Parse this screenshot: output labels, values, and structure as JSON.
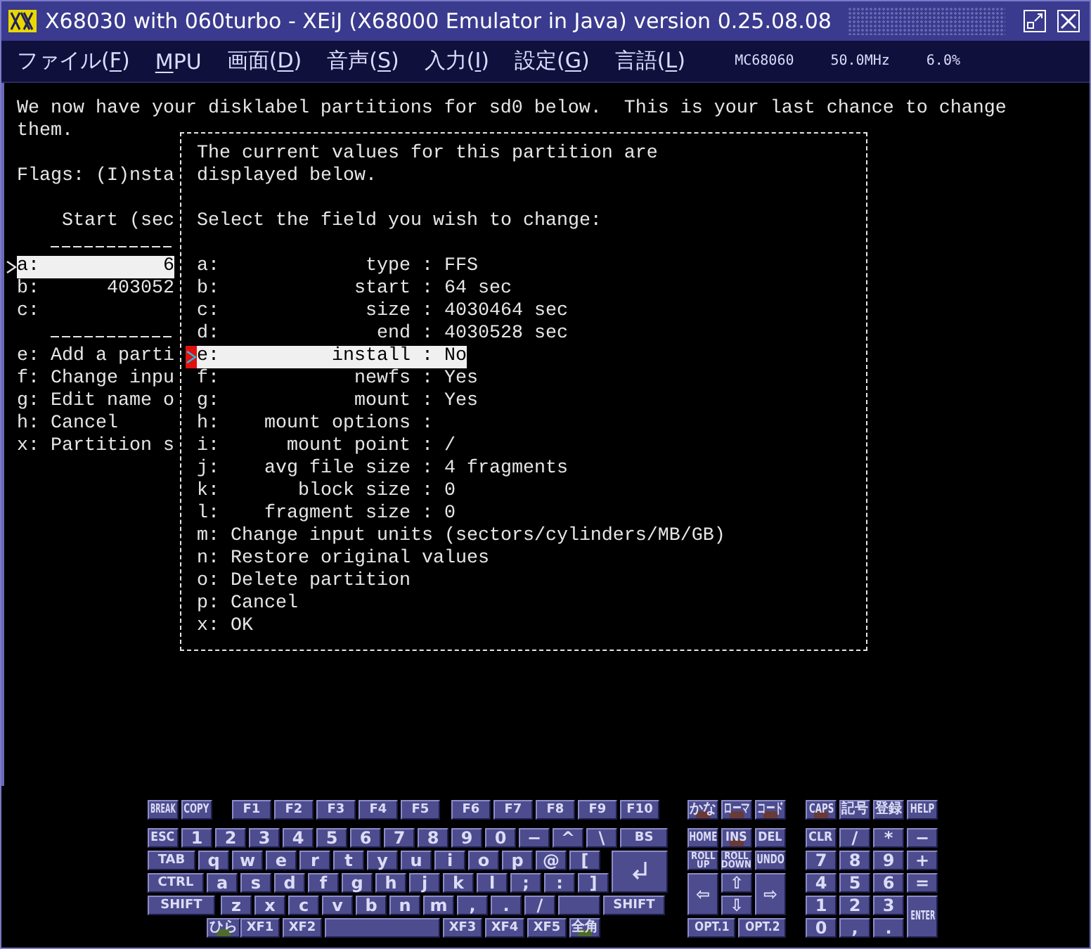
{
  "window": {
    "title": "X68030 with 060turbo - XEiJ (X68000 Emulator in Java) version 0.25.08.08"
  },
  "menu": [
    {
      "before": "ファイル(",
      "key": "F",
      "after": ")"
    },
    {
      "key": "M",
      "after": "PU"
    },
    {
      "before": "画面(",
      "key": "D",
      "after": ")"
    },
    {
      "before": "音声(",
      "key": "S",
      "after": ")"
    },
    {
      "before": "入力(",
      "key": "I",
      "after": ")"
    },
    {
      "before": "設定(",
      "key": "G",
      "after": ")"
    },
    {
      "before": "言語(",
      "key": "L",
      "after": ")"
    }
  ],
  "status": [
    "MC68060",
    "50.0MHz",
    "6.0%"
  ],
  "terminal": {
    "intro": "We now have your disklabel partitions for sd0 below.  This is your last chance to change them.",
    "flags": "Flags: (I)nsta",
    "table_header": "Start (sec",
    "partitions": [
      {
        "text": "a:           6",
        "selected": true
      },
      {
        "text": "b:      403052",
        "selected": false
      },
      {
        "text": "c:",
        "selected": false
      }
    ],
    "actions": [
      "e: Add a parti",
      "f: Change inpu",
      "g: Edit name o",
      "h: Cancel",
      "x: Partition s"
    ]
  },
  "dialog": {
    "intro": "The current values for this partition are displayed below.",
    "prompt": "Select the field you wish to change:",
    "fields": [
      {
        "text": "a:             type : FFS",
        "selected": false
      },
      {
        "text": "b:            start : 64 sec",
        "selected": false
      },
      {
        "text": "c:             size : 4030464 sec",
        "selected": false
      },
      {
        "text": "d:              end : 4030528 sec",
        "selected": false
      },
      {
        "text": "e:          install : No",
        "selected": true
      },
      {
        "text": "f:            newfs : Yes",
        "selected": false
      },
      {
        "text": "g:            mount : Yes",
        "selected": false
      },
      {
        "text": "h:    mount options :",
        "selected": false
      },
      {
        "text": "i:      mount point : /",
        "selected": false
      },
      {
        "text": "j:    avg file size : 4 fragments",
        "selected": false
      },
      {
        "text": "k:       block size : 0",
        "selected": false
      },
      {
        "text": "l:    fragment size : 0",
        "selected": false
      }
    ],
    "options": [
      "m: Change input units (sectors/cylinders/MB/GB)",
      "n: Restore original values",
      "o: Delete partition",
      "p: Cancel",
      "x: OK"
    ]
  },
  "keyboard": {
    "main": [
      [
        {
          "label": "BREAK",
          "kind": "key"
        },
        {
          "label": "COPY",
          "kind": "copy"
        },
        {
          "label": "F1",
          "kind": "fn"
        },
        {
          "label": "F2",
          "kind": "fn"
        },
        {
          "label": "F3",
          "kind": "fn"
        },
        {
          "label": "F4",
          "kind": "fn"
        },
        {
          "label": "F5",
          "kind": "fngap"
        },
        {
          "label": "F6",
          "kind": "fn"
        },
        {
          "label": "F7",
          "kind": "fn"
        },
        {
          "label": "F8",
          "kind": "fn"
        },
        {
          "label": "F9",
          "kind": "fn"
        },
        {
          "label": "F10",
          "kind": "fn"
        }
      ],
      [
        {
          "label": "ESC",
          "kind": "key"
        },
        {
          "label": "1",
          "kind": "key"
        },
        {
          "label": "2",
          "kind": "key"
        },
        {
          "label": "3",
          "kind": "key"
        },
        {
          "label": "4",
          "kind": "key"
        },
        {
          "label": "5",
          "kind": "key"
        },
        {
          "label": "6",
          "kind": "key"
        },
        {
          "label": "7",
          "kind": "key"
        },
        {
          "label": "8",
          "kind": "key"
        },
        {
          "label": "9",
          "kind": "key"
        },
        {
          "label": "0",
          "kind": "key"
        },
        {
          "label": "−",
          "kind": "key"
        },
        {
          "label": "^",
          "kind": "key"
        },
        {
          "label": "\\",
          "kind": "key"
        },
        {
          "label": "BS",
          "kind": "bs"
        }
      ],
      [
        {
          "label": "TAB",
          "kind": "tab"
        },
        {
          "label": "q",
          "kind": "key"
        },
        {
          "label": "w",
          "kind": "key"
        },
        {
          "label": "e",
          "kind": "key"
        },
        {
          "label": "r",
          "kind": "key"
        },
        {
          "label": "t",
          "kind": "key"
        },
        {
          "label": "y",
          "kind": "key"
        },
        {
          "label": "u",
          "kind": "key"
        },
        {
          "label": "i",
          "kind": "key"
        },
        {
          "label": "o",
          "kind": "key"
        },
        {
          "label": "p",
          "kind": "key"
        },
        {
          "label": "@",
          "kind": "key"
        },
        {
          "label": "[",
          "kind": "key"
        },
        {
          "kind": "return"
        }
      ],
      [
        {
          "label": "CTRL",
          "kind": "ctrl"
        },
        {
          "label": "a",
          "kind": "key"
        },
        {
          "label": "s",
          "kind": "key"
        },
        {
          "label": "d",
          "kind": "key"
        },
        {
          "label": "f",
          "kind": "key"
        },
        {
          "label": "g",
          "kind": "key"
        },
        {
          "label": "h",
          "kind": "key"
        },
        {
          "label": "j",
          "kind": "key"
        },
        {
          "label": "k",
          "kind": "key"
        },
        {
          "label": "l",
          "kind": "key"
        },
        {
          "label": ";",
          "kind": "key"
        },
        {
          "label": ":",
          "kind": "key"
        },
        {
          "label": "]",
          "kind": "key"
        }
      ],
      [
        {
          "label": "SHIFT",
          "kind": "lshift"
        },
        {
          "label": "z",
          "kind": "key"
        },
        {
          "label": "x",
          "kind": "key"
        },
        {
          "label": "c",
          "kind": "key"
        },
        {
          "label": "v",
          "kind": "key"
        },
        {
          "label": "b",
          "kind": "key"
        },
        {
          "label": "n",
          "kind": "key"
        },
        {
          "label": "m",
          "kind": "key"
        },
        {
          "label": ",",
          "kind": "key"
        },
        {
          "label": ".",
          "kind": "key"
        },
        {
          "label": "/",
          "kind": "key"
        },
        {
          "kind": "blank"
        },
        {
          "label": "SHIFT",
          "kind": "rshift"
        }
      ],
      [
        {
          "label": "ひら",
          "kind": "hira",
          "color": "#4e6a2c"
        },
        {
          "label": "XF1",
          "kind": "xf"
        },
        {
          "label": "XF2",
          "kind": "xf"
        },
        {
          "kind": "space"
        },
        {
          "label": "XF3",
          "kind": "xf"
        },
        {
          "label": "XF4",
          "kind": "xf"
        },
        {
          "label": "XF5",
          "kind": "xf"
        },
        {
          "label": "全角",
          "kind": "key",
          "color": "#4e6a2c"
        }
      ]
    ],
    "edit": [
      [
        {
          "label": "かな",
          "kind": "key",
          "color": "#6a3a36"
        },
        {
          "label": "ローマ",
          "kind": "key",
          "color": "#6a3a36"
        },
        {
          "label": "コード",
          "kind": "key",
          "color": "#6a3a36"
        }
      ],
      [
        {
          "label": "HOME",
          "kind": "key"
        },
        {
          "label": "INS",
          "kind": "key",
          "color": "#6a3a36"
        },
        {
          "label": "DEL",
          "kind": "key"
        }
      ],
      [
        {
          "label": "ROLL UP",
          "kind": "roll"
        },
        {
          "label": "ROLL DOWN",
          "kind": "roll"
        },
        {
          "label": "UNDO",
          "kind": "key"
        }
      ],
      [
        {
          "label": "⇦",
          "kind": "left"
        },
        {
          "label": "⇧",
          "kind": "key"
        },
        {
          "label": "⇨",
          "kind": "right"
        }
      ],
      [
        {
          "label": "⇩",
          "kind": "key"
        }
      ],
      [
        {
          "label": "OPT.1",
          "kind": "opt"
        },
        {
          "label": "OPT.2",
          "kind": "opt"
        }
      ]
    ],
    "numpad": [
      [
        {
          "label": "CAPS",
          "kind": "key",
          "color": "#6a3a36"
        },
        {
          "label": "記号",
          "kind": "key"
        },
        {
          "label": "登録",
          "kind": "key"
        },
        {
          "label": "HELP",
          "kind": "key"
        }
      ],
      [
        {
          "label": "CLR",
          "kind": "key"
        },
        {
          "label": "/",
          "kind": "key"
        },
        {
          "label": "*",
          "kind": "key"
        },
        {
          "label": "−",
          "kind": "key"
        }
      ],
      [
        {
          "label": "7",
          "kind": "key"
        },
        {
          "label": "8",
          "kind": "key"
        },
        {
          "label": "9",
          "kind": "key"
        },
        {
          "label": "+",
          "kind": "key"
        }
      ],
      [
        {
          "label": "4",
          "kind": "key"
        },
        {
          "label": "5",
          "kind": "key"
        },
        {
          "label": "6",
          "kind": "key"
        },
        {
          "label": "=",
          "kind": "key"
        }
      ],
      [
        {
          "label": "1",
          "kind": "key"
        },
        {
          "label": "2",
          "kind": "key"
        },
        {
          "label": "3",
          "kind": "key"
        },
        {
          "label": "ENTER",
          "kind": "enter"
        }
      ],
      [
        {
          "label": "0",
          "kind": "key"
        },
        {
          "label": ",",
          "kind": "key"
        },
        {
          "label": ".",
          "kind": "key"
        }
      ]
    ]
  }
}
